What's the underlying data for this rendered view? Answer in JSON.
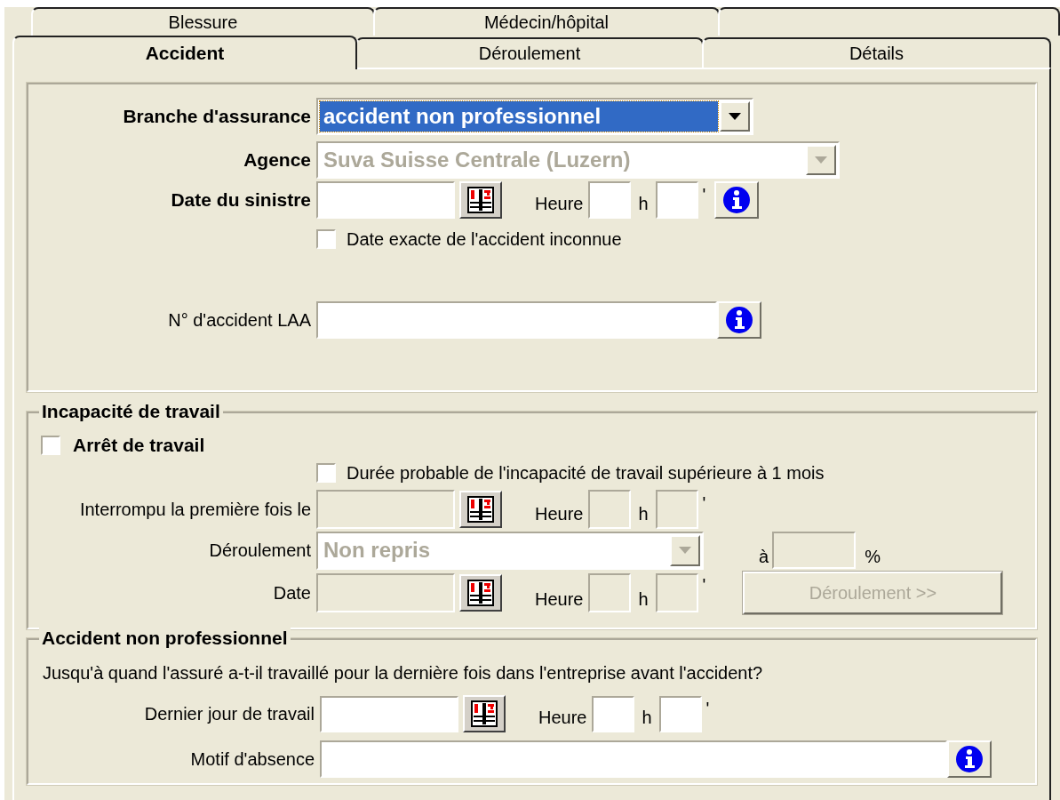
{
  "tabs_back": [
    {
      "label": "Blessure",
      "selected": false
    },
    {
      "label": "Médecin/hôpital",
      "selected": false
    },
    {
      "selected": false
    }
  ],
  "tabs_front": [
    {
      "label": "Accident",
      "selected": true
    },
    {
      "label": "Déroulement",
      "selected": false
    },
    {
      "label": "Détails",
      "selected": false
    }
  ],
  "accident": {
    "branche": {
      "label": "Branche d'assurance",
      "value": "accident non professionnel",
      "focused": true
    },
    "agence": {
      "label": "Agence",
      "value": "Suva Suisse Centrale (Luzern)",
      "focused": false,
      "disabled": true
    },
    "date_sinistre": {
      "label": "Date du sinistre",
      "hour_label": "Heure",
      "hour_unit": "h",
      "minute_unit": "'",
      "disabled": false
    },
    "date_unknown": {
      "label": "Date exacte de l'accident inconnue",
      "checked": false
    },
    "accident_number": {
      "label": "N° d'accident LAA"
    }
  },
  "incapacite": {
    "title": "Incapacité de travail",
    "arret": {
      "label": "Arrêt de travail",
      "checked": false
    },
    "duree": {
      "label": "Durée probable de l'incapacité de travail supérieure à 1 mois",
      "checked": false
    },
    "interrompu": {
      "label": "Interrompu la première fois le",
      "hour_label": "Heure",
      "hour_unit": "h",
      "minute_unit": "'",
      "disabled": true
    },
    "deroulement": {
      "label": "Déroulement",
      "value": "Non repris",
      "disabled": true,
      "percent_prefix": "à",
      "percent_unit": "%"
    },
    "date": {
      "label": "Date",
      "hour_label": "Heure",
      "hour_unit": "h",
      "minute_unit": "'",
      "disabled": true
    },
    "button": {
      "label": "Déroulement >>",
      "disabled": true
    }
  },
  "non_professionnel": {
    "title": "Accident non professionnel",
    "question": "Jusqu'à quand l'assuré a-t-il travaillé pour la dernière fois dans l'entreprise avant l'accident?",
    "dernier_jour": {
      "label": "Dernier jour de travail",
      "hour_label": "Heure",
      "hour_unit": "h",
      "minute_unit": "'",
      "disabled": false
    },
    "motif": {
      "label": "Motif d'absence"
    }
  }
}
